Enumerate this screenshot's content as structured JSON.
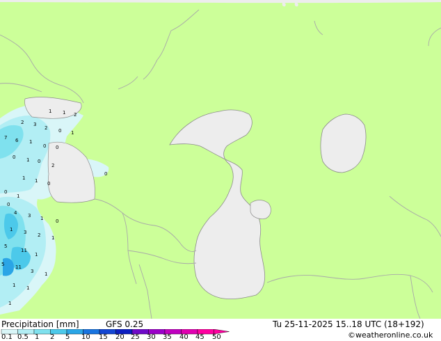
{
  "product": {
    "title": "Precipitation [mm]",
    "model": "GFS 0.25",
    "valid_time": "Tu 25-11-2025 15..18 UTC (18+192)",
    "credit": "©weatheronline.co.uk"
  },
  "legend": {
    "scale_labels": [
      "0.1",
      "0.5",
      "1",
      "2",
      "5",
      "10",
      "15",
      "20",
      "25",
      "30",
      "35",
      "40",
      "45",
      "50"
    ],
    "colors": [
      "#d9f6f8",
      "#b2eef4",
      "#7fe1ee",
      "#4cc9ea",
      "#2aa5e6",
      "#1874e0",
      "#1446d2",
      "#0c1ec0",
      "#6f0ac8",
      "#9a00c8",
      "#c000c0",
      "#e000b0",
      "#ff00a0"
    ]
  },
  "colors": {
    "land": "#ccff99",
    "water": "#ededed",
    "border": "#a8a8a8",
    "coast": "#8c8c8c"
  },
  "precip_values": [
    "1",
    "1",
    "2",
    "2",
    "3",
    "2",
    "0",
    "1",
    "7",
    "6",
    "1",
    "0",
    "0",
    "0",
    "1",
    "0",
    "2",
    "1",
    "1",
    "0",
    "0",
    "0",
    "1",
    "0",
    "4",
    "3",
    "1",
    "0",
    "1",
    "3",
    "2",
    "1",
    "5",
    "11",
    "1",
    "5",
    "11",
    "3",
    "1",
    "1",
    "1",
    "1"
  ]
}
